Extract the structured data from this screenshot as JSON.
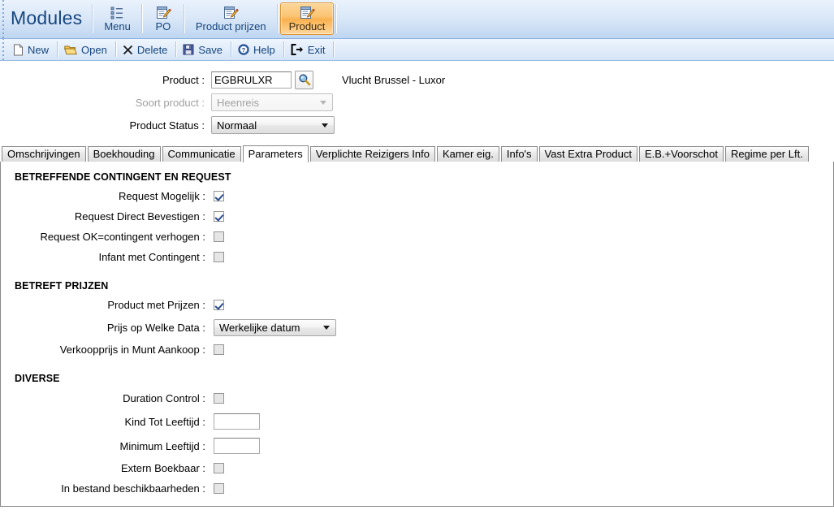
{
  "modules_bar": {
    "title": "Modules",
    "buttons": [
      {
        "label": "Menu",
        "icon": "list-icon",
        "active": false
      },
      {
        "label": "PO",
        "icon": "edit-document-icon",
        "active": false
      },
      {
        "label": "Product prijzen",
        "icon": "edit-document-icon",
        "active": false
      },
      {
        "label": "Product",
        "icon": "edit-document-icon",
        "active": true
      }
    ],
    "accent_active": "#f9b14e",
    "text_color": "#15457c"
  },
  "action_bar": {
    "buttons": [
      {
        "label": "New",
        "icon": "page-icon"
      },
      {
        "label": "Open",
        "icon": "folder-open-icon"
      },
      {
        "label": "Delete",
        "icon": "x-icon"
      },
      {
        "label": "Save",
        "icon": "floppy-disk-icon"
      },
      {
        "label": "Help",
        "icon": "question-circle-icon"
      },
      {
        "label": "Exit",
        "icon": "exit-arrow-icon"
      }
    ]
  },
  "form": {
    "product": {
      "label": "Product :",
      "value": "EGBRULXR",
      "placeholder": "",
      "search_icon": "magnifier-icon",
      "description": "Vlucht Brussel - Luxor"
    },
    "soort_product": {
      "label": "Soort product :",
      "value": "Heenreis",
      "disabled": true
    },
    "product_status": {
      "label": "Product Status :",
      "value": "Normaal",
      "disabled": false
    }
  },
  "tabs": [
    {
      "label": "Omschrijvingen",
      "active": false
    },
    {
      "label": "Boekhouding",
      "active": false
    },
    {
      "label": "Communicatie",
      "active": false
    },
    {
      "label": "Parameters",
      "active": true
    },
    {
      "label": "Verplichte Reizigers Info",
      "active": false
    },
    {
      "label": "Kamer eig.",
      "active": false
    },
    {
      "label": "Info's",
      "active": false
    },
    {
      "label": "Vast Extra Product",
      "active": false
    },
    {
      "label": "E.B.+Voorschot",
      "active": false
    },
    {
      "label": "Regime per Lft.",
      "active": false
    }
  ],
  "panel": {
    "sections": [
      {
        "heading": "BETREFFENDE CONTINGENT EN REQUEST",
        "fields": [
          {
            "label": "Request Mogelijk :",
            "type": "checkbox",
            "checked": true
          },
          {
            "label": "Request Direct Bevestigen :",
            "type": "checkbox",
            "checked": true
          },
          {
            "label": "Request OK=contingent verhogen :",
            "type": "checkbox",
            "checked": false
          },
          {
            "label": "Infant met Contingent :",
            "type": "checkbox",
            "checked": false
          }
        ]
      },
      {
        "heading": "BETREFT PRIJZEN",
        "fields": [
          {
            "label": "Product met Prijzen :",
            "type": "checkbox",
            "checked": true
          },
          {
            "label": "Prijs op Welke Data :",
            "type": "combo",
            "value": "Werkelijke datum"
          },
          {
            "label": "Verkoopprijs in Munt Aankoop :",
            "type": "checkbox",
            "checked": false
          }
        ]
      },
      {
        "heading": "DIVERSE",
        "fields": [
          {
            "label": "Duration Control :",
            "type": "checkbox",
            "checked": false
          },
          {
            "label": "Kind Tot Leeftijd :",
            "type": "text",
            "value": ""
          },
          {
            "label": "Minimum Leeftijd :",
            "type": "text",
            "value": ""
          },
          {
            "label": "Extern Boekbaar :",
            "type": "checkbox",
            "checked": false
          },
          {
            "label": "In bestand beschikbaarheden :",
            "type": "checkbox",
            "checked": false
          }
        ]
      }
    ]
  }
}
